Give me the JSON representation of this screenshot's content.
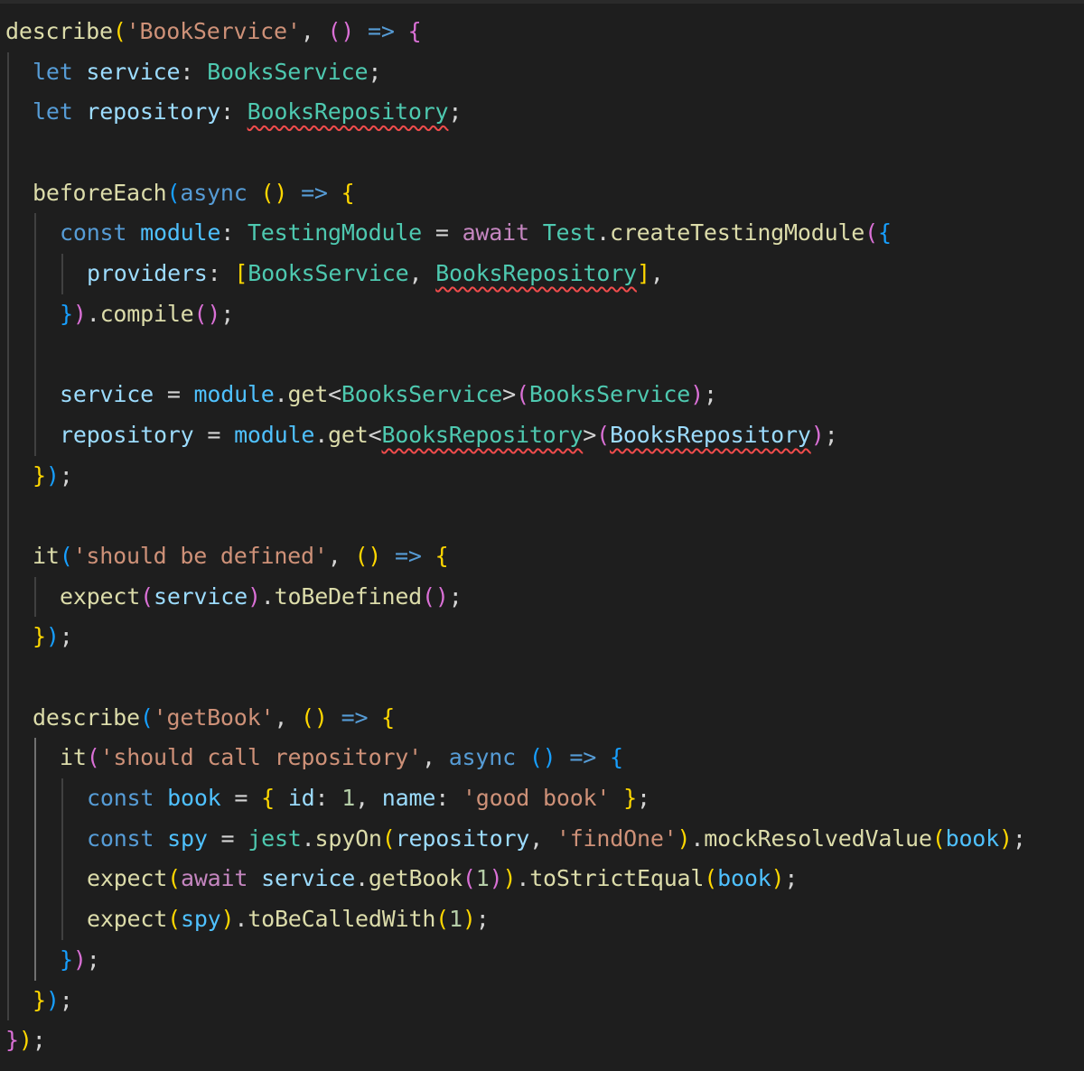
{
  "editor": {
    "language": "typescript",
    "theme_colors": {
      "background": "#1e1e1e",
      "function": "#dcdcaa",
      "string": "#ce9178",
      "keyword": "#569cd6",
      "variable": "#9cdcfe",
      "type": "#4ec9b0",
      "control": "#c586c0",
      "number": "#b5cea8",
      "bracket1": "#ffd700",
      "bracket2": "#da70d6",
      "bracket3": "#179fff",
      "error_squiggle": "#f14c4c"
    },
    "lines": [
      {
        "indent": 0,
        "tokens": [
          [
            "describe",
            "fn"
          ],
          [
            "(",
            "b1"
          ],
          [
            "'BookService'",
            "str"
          ],
          [
            ", ",
            "punc"
          ],
          [
            "()",
            "b2"
          ],
          [
            " ",
            "punc"
          ],
          [
            "=>",
            "kw"
          ],
          [
            " ",
            "punc"
          ],
          [
            "{",
            "b2"
          ]
        ]
      },
      {
        "indent": 1,
        "tokens": [
          [
            "let",
            "kw"
          ],
          [
            " ",
            "punc"
          ],
          [
            "service",
            "var"
          ],
          [
            ": ",
            "punc"
          ],
          [
            "BooksService",
            "type"
          ],
          [
            ";",
            "punc"
          ]
        ]
      },
      {
        "indent": 1,
        "tokens": [
          [
            "let",
            "kw"
          ],
          [
            " ",
            "punc"
          ],
          [
            "repository",
            "var"
          ],
          [
            ": ",
            "punc"
          ],
          [
            "BooksRepository",
            "type",
            true
          ],
          [
            ";",
            "punc"
          ]
        ]
      },
      {
        "indent": 1,
        "tokens": []
      },
      {
        "indent": 1,
        "tokens": [
          [
            "beforeEach",
            "fn"
          ],
          [
            "(",
            "b3"
          ],
          [
            "async",
            "kw"
          ],
          [
            " ",
            "punc"
          ],
          [
            "()",
            "b1"
          ],
          [
            " ",
            "punc"
          ],
          [
            "=>",
            "kw"
          ],
          [
            " ",
            "punc"
          ],
          [
            "{",
            "b1"
          ]
        ]
      },
      {
        "indent": 2,
        "tokens": [
          [
            "const",
            "kw"
          ],
          [
            " ",
            "punc"
          ],
          [
            "module",
            "cst"
          ],
          [
            ": ",
            "punc"
          ],
          [
            "TestingModule",
            "type"
          ],
          [
            " = ",
            "punc"
          ],
          [
            "await",
            "ctrl"
          ],
          [
            " ",
            "punc"
          ],
          [
            "Test",
            "type"
          ],
          [
            ".",
            "punc"
          ],
          [
            "createTestingModule",
            "fn"
          ],
          [
            "(",
            "b2"
          ],
          [
            "{",
            "b3"
          ]
        ]
      },
      {
        "indent": 3,
        "tokens": [
          [
            "providers",
            "var"
          ],
          [
            ": ",
            "punc"
          ],
          [
            "[",
            "b1"
          ],
          [
            "BooksService",
            "type"
          ],
          [
            ", ",
            "punc"
          ],
          [
            "BooksRepository",
            "type",
            true
          ],
          [
            "]",
            "b1"
          ],
          [
            ",",
            "punc"
          ]
        ]
      },
      {
        "indent": 2,
        "tokens": [
          [
            "}",
            "b3"
          ],
          [
            ")",
            "b2"
          ],
          [
            ".",
            "punc"
          ],
          [
            "compile",
            "fn"
          ],
          [
            "()",
            "b2"
          ],
          [
            ";",
            "punc"
          ]
        ]
      },
      {
        "indent": 2,
        "tokens": []
      },
      {
        "indent": 2,
        "tokens": [
          [
            "service",
            "var"
          ],
          [
            " = ",
            "punc"
          ],
          [
            "module",
            "cst"
          ],
          [
            ".",
            "punc"
          ],
          [
            "get",
            "fn"
          ],
          [
            "<",
            "punc"
          ],
          [
            "BooksService",
            "type"
          ],
          [
            ">",
            "punc"
          ],
          [
            "(",
            "b2"
          ],
          [
            "BooksService",
            "type"
          ],
          [
            ")",
            "b2"
          ],
          [
            ";",
            "punc"
          ]
        ]
      },
      {
        "indent": 2,
        "tokens": [
          [
            "repository",
            "var"
          ],
          [
            " = ",
            "punc"
          ],
          [
            "module",
            "cst"
          ],
          [
            ".",
            "punc"
          ],
          [
            "get",
            "fn"
          ],
          [
            "<",
            "punc"
          ],
          [
            "BooksRepository",
            "type",
            true
          ],
          [
            ">",
            "punc"
          ],
          [
            "(",
            "b2"
          ],
          [
            "BooksRepository",
            "var",
            true
          ],
          [
            ")",
            "b2"
          ],
          [
            ";",
            "punc"
          ]
        ]
      },
      {
        "indent": 1,
        "tokens": [
          [
            "}",
            "b1"
          ],
          [
            ")",
            "b3"
          ],
          [
            ";",
            "punc"
          ]
        ]
      },
      {
        "indent": 1,
        "tokens": []
      },
      {
        "indent": 1,
        "tokens": [
          [
            "it",
            "fn"
          ],
          [
            "(",
            "b3"
          ],
          [
            "'should be defined'",
            "str"
          ],
          [
            ", ",
            "punc"
          ],
          [
            "()",
            "b1"
          ],
          [
            " ",
            "punc"
          ],
          [
            "=>",
            "kw"
          ],
          [
            " ",
            "punc"
          ],
          [
            "{",
            "b1"
          ]
        ]
      },
      {
        "indent": 2,
        "tokens": [
          [
            "expect",
            "fn"
          ],
          [
            "(",
            "b2"
          ],
          [
            "service",
            "var"
          ],
          [
            ")",
            "b2"
          ],
          [
            ".",
            "punc"
          ],
          [
            "toBeDefined",
            "fn"
          ],
          [
            "()",
            "b2"
          ],
          [
            ";",
            "punc"
          ]
        ]
      },
      {
        "indent": 1,
        "tokens": [
          [
            "}",
            "b1"
          ],
          [
            ")",
            "b3"
          ],
          [
            ";",
            "punc"
          ]
        ]
      },
      {
        "indent": 1,
        "tokens": []
      },
      {
        "indent": 1,
        "tokens": [
          [
            "describe",
            "fn"
          ],
          [
            "(",
            "b3"
          ],
          [
            "'getBook'",
            "str"
          ],
          [
            ", ",
            "punc"
          ],
          [
            "()",
            "b1"
          ],
          [
            " ",
            "punc"
          ],
          [
            "=>",
            "kw"
          ],
          [
            " ",
            "punc"
          ],
          [
            "{",
            "b1"
          ]
        ]
      },
      {
        "indent": 2,
        "tokens": [
          [
            "it",
            "fn"
          ],
          [
            "(",
            "b2"
          ],
          [
            "'should call repository'",
            "str"
          ],
          [
            ", ",
            "punc"
          ],
          [
            "async",
            "kw"
          ],
          [
            " ",
            "punc"
          ],
          [
            "()",
            "b3"
          ],
          [
            " ",
            "punc"
          ],
          [
            "=>",
            "kw"
          ],
          [
            " ",
            "punc"
          ],
          [
            "{",
            "b3"
          ]
        ]
      },
      {
        "indent": 3,
        "tokens": [
          [
            "const",
            "kw"
          ],
          [
            " ",
            "punc"
          ],
          [
            "book",
            "cst"
          ],
          [
            " = ",
            "punc"
          ],
          [
            "{",
            "b1"
          ],
          [
            " ",
            "punc"
          ],
          [
            "id",
            "var"
          ],
          [
            ": ",
            "punc"
          ],
          [
            "1",
            "num"
          ],
          [
            ", ",
            "punc"
          ],
          [
            "name",
            "var"
          ],
          [
            ": ",
            "punc"
          ],
          [
            "'good book'",
            "str"
          ],
          [
            " ",
            "punc"
          ],
          [
            "}",
            "b1"
          ],
          [
            ";",
            "punc"
          ]
        ]
      },
      {
        "indent": 3,
        "tokens": [
          [
            "const",
            "kw"
          ],
          [
            " ",
            "punc"
          ],
          [
            "spy",
            "cst"
          ],
          [
            " = ",
            "punc"
          ],
          [
            "jest",
            "type"
          ],
          [
            ".",
            "punc"
          ],
          [
            "spyOn",
            "fn"
          ],
          [
            "(",
            "b1"
          ],
          [
            "repository",
            "var"
          ],
          [
            ", ",
            "punc"
          ],
          [
            "'findOne'",
            "str"
          ],
          [
            ")",
            "b1"
          ],
          [
            ".",
            "punc"
          ],
          [
            "mockResolvedValue",
            "fn"
          ],
          [
            "(",
            "b1"
          ],
          [
            "book",
            "cst"
          ],
          [
            ")",
            "b1"
          ],
          [
            ";",
            "punc"
          ]
        ]
      },
      {
        "indent": 3,
        "tokens": [
          [
            "expect",
            "fn"
          ],
          [
            "(",
            "b1"
          ],
          [
            "await",
            "ctrl"
          ],
          [
            " ",
            "punc"
          ],
          [
            "service",
            "var"
          ],
          [
            ".",
            "punc"
          ],
          [
            "getBook",
            "fn"
          ],
          [
            "(",
            "b2"
          ],
          [
            "1",
            "num"
          ],
          [
            ")",
            "b2"
          ],
          [
            ")",
            "b1"
          ],
          [
            ".",
            "punc"
          ],
          [
            "toStrictEqual",
            "fn"
          ],
          [
            "(",
            "b1"
          ],
          [
            "book",
            "cst"
          ],
          [
            ")",
            "b1"
          ],
          [
            ";",
            "punc"
          ]
        ]
      },
      {
        "indent": 3,
        "tokens": [
          [
            "expect",
            "fn"
          ],
          [
            "(",
            "b1"
          ],
          [
            "spy",
            "cst"
          ],
          [
            ")",
            "b1"
          ],
          [
            ".",
            "punc"
          ],
          [
            "toBeCalledWith",
            "fn"
          ],
          [
            "(",
            "b1"
          ],
          [
            "1",
            "num"
          ],
          [
            ")",
            "b1"
          ],
          [
            ";",
            "punc"
          ]
        ]
      },
      {
        "indent": 2,
        "tokens": [
          [
            "}",
            "b3"
          ],
          [
            ")",
            "b2"
          ],
          [
            ";",
            "punc"
          ]
        ]
      },
      {
        "indent": 1,
        "tokens": [
          [
            "}",
            "b1"
          ],
          [
            ")",
            "b3"
          ],
          [
            ";",
            "punc"
          ]
        ]
      },
      {
        "indent": 0,
        "tokens": [
          [
            "}",
            "b2"
          ],
          [
            ")",
            "b1"
          ],
          [
            ";",
            "punc"
          ]
        ]
      }
    ]
  }
}
